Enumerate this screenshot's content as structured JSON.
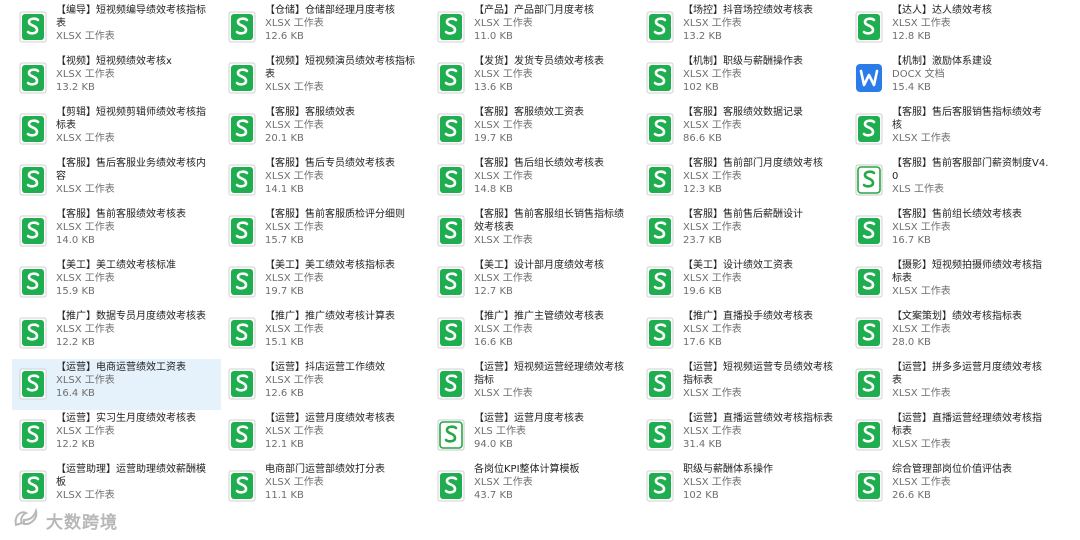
{
  "files": [
    {
      "name": "【编导】短视频编导绩效考核指标表",
      "type": "XLSX 工作表",
      "size": "",
      "icon": "xlsx-icon"
    },
    {
      "name": "【视频】短视频绩效考核x",
      "type": "XLSX 工作表",
      "size": "13.2 KB",
      "icon": "xlsx-icon"
    },
    {
      "name": "【剪辑】短视频剪辑师绩效考核指标表",
      "type": "XLSX 工作表",
      "size": "",
      "icon": "xlsx-icon"
    },
    {
      "name": "【客服】售后客服业务绩效考核内容",
      "type": "XLSX 工作表",
      "size": "",
      "icon": "xlsx-icon"
    },
    {
      "name": "【客服】售前客服绩效考核表",
      "type": "XLSX 工作表",
      "size": "14.0 KB",
      "icon": "xlsx-icon"
    },
    {
      "name": "【美工】美工绩效考核标准",
      "type": "XLSX 工作表",
      "size": "15.9 KB",
      "icon": "xlsx-icon"
    },
    {
      "name": "【推广】数据专员月度绩效考核表",
      "type": "XLSX 工作表",
      "size": "12.2 KB",
      "icon": "xlsx-icon"
    },
    {
      "name": "【运营】电商运营绩效工资表",
      "type": "XLSX 工作表",
      "size": "16.4 KB",
      "icon": "xlsx-icon",
      "selected": true
    },
    {
      "name": "【运营】实习生月度绩效考核表",
      "type": "XLSX 工作表",
      "size": "12.2 KB",
      "icon": "xlsx-icon"
    },
    {
      "name": "【运营助理】运营助理绩效薪酬模板",
      "type": "XLSX 工作表",
      "size": "",
      "icon": "xlsx-icon"
    },
    {
      "name": "【仓储】仓储部经理月度考核",
      "type": "XLSX 工作表",
      "size": "12.6 KB",
      "icon": "xlsx-icon"
    },
    {
      "name": "【视频】短视频演员绩效考核指标表",
      "type": "XLSX 工作表",
      "size": "",
      "icon": "xlsx-icon"
    },
    {
      "name": "【客服】客服绩效表",
      "type": "XLSX 工作表",
      "size": "20.1 KB",
      "icon": "xlsx-icon"
    },
    {
      "name": "【客服】售后专员绩效考核表",
      "type": "XLSX 工作表",
      "size": "14.1 KB",
      "icon": "xlsx-icon"
    },
    {
      "name": "【客服】售前客服质检评分细则",
      "type": "XLSX 工作表",
      "size": "15.7 KB",
      "icon": "xlsx-icon"
    },
    {
      "name": "【美工】美工绩效考核指标表",
      "type": "XLSX 工作表",
      "size": "19.7 KB",
      "icon": "xlsx-icon"
    },
    {
      "name": "【推广】推广绩效考核计算表",
      "type": "XLSX 工作表",
      "size": "15.1 KB",
      "icon": "xlsx-icon"
    },
    {
      "name": "【运营】抖店运营工作绩效",
      "type": "XLSX 工作表",
      "size": "12.6 KB",
      "icon": "xlsx-icon"
    },
    {
      "name": "【运营】运营月度绩效考核表",
      "type": "XLSX 工作表",
      "size": "12.1 KB",
      "icon": "xlsx-icon"
    },
    {
      "name": "电商部门运营部绩效打分表",
      "type": "XLSX 工作表",
      "size": "11.1 KB",
      "icon": "xlsx-icon"
    },
    {
      "name": "【产品】产品部门月度考核",
      "type": "XLSX 工作表",
      "size": "11.0 KB",
      "icon": "xlsx-icon"
    },
    {
      "name": "【发货】发货专员绩效考核表",
      "type": "XLSX 工作表",
      "size": "13.6 KB",
      "icon": "xlsx-icon"
    },
    {
      "name": "【客服】客服绩效工资表",
      "type": "XLSX 工作表",
      "size": "19.7 KB",
      "icon": "xlsx-icon"
    },
    {
      "name": "【客服】售后组长绩效考核表",
      "type": "XLSX 工作表",
      "size": "14.8 KB",
      "icon": "xlsx-icon"
    },
    {
      "name": "【客服】售前客服组长销售指标绩效考核表",
      "type": "XLSX 工作表",
      "size": "",
      "icon": "xlsx-icon"
    },
    {
      "name": "【美工】设计部月度绩效考核",
      "type": "XLSX 工作表",
      "size": "12.7 KB",
      "icon": "xlsx-icon"
    },
    {
      "name": "【推广】推广主管绩效考核表",
      "type": "XLSX 工作表",
      "size": "16.6 KB",
      "icon": "xlsx-icon"
    },
    {
      "name": "【运营】短视频运营经理绩效考核指标",
      "type": "XLSX 工作表",
      "size": "",
      "icon": "xlsx-icon"
    },
    {
      "name": "【运营】运营月度考核表",
      "type": "XLS 工作表",
      "size": "94.0 KB",
      "icon": "xls-icon"
    },
    {
      "name": "各岗位KPI整体计算模板",
      "type": "XLSX 工作表",
      "size": "43.7 KB",
      "icon": "xlsx-icon"
    },
    {
      "name": "【场控】抖音场控绩效考核表",
      "type": "XLSX 工作表",
      "size": "13.2 KB",
      "icon": "xlsx-icon"
    },
    {
      "name": "【机制】职级与薪酬操作表",
      "type": "XLSX 工作表",
      "size": "102 KB",
      "icon": "xlsx-icon"
    },
    {
      "name": "【客服】客服绩效数据记录",
      "type": "XLSX 工作表",
      "size": "86.6 KB",
      "icon": "xlsx-icon"
    },
    {
      "name": "【客服】售前部门月度绩效考核",
      "type": "XLSX 工作表",
      "size": "12.3 KB",
      "icon": "xlsx-icon"
    },
    {
      "name": "【客服】售前售后薪酬设计",
      "type": "XLSX 工作表",
      "size": "23.7 KB",
      "icon": "xlsx-icon"
    },
    {
      "name": "【美工】设计绩效工资表",
      "type": "XLSX 工作表",
      "size": "19.6 KB",
      "icon": "xlsx-icon"
    },
    {
      "name": "【推广】直播投手绩效考核表",
      "type": "XLSX 工作表",
      "size": "17.6 KB",
      "icon": "xlsx-icon"
    },
    {
      "name": "【运营】短视频运营专员绩效考核指标表",
      "type": "XLSX 工作表",
      "size": "",
      "icon": "xlsx-icon"
    },
    {
      "name": "【运营】直播运营绩效考核指标表",
      "type": "XLSX 工作表",
      "size": "31.4 KB",
      "icon": "xlsx-icon"
    },
    {
      "name": "职级与薪酬体系操作",
      "type": "XLSX 工作表",
      "size": "102 KB",
      "icon": "xlsx-icon"
    },
    {
      "name": "【达人】达人绩效考核",
      "type": "XLSX 工作表",
      "size": "12.8 KB",
      "icon": "xlsx-icon"
    },
    {
      "name": "【机制】激励体系建设",
      "type": "DOCX 文档",
      "size": "15.4 KB",
      "icon": "docx-icon"
    },
    {
      "name": "【客服】售后客服销售指标绩效考核",
      "type": "XLSX 工作表",
      "size": "",
      "icon": "xlsx-icon"
    },
    {
      "name": "【客服】售前客服部门薪资制度V4.0",
      "type": "XLS 工作表",
      "size": "",
      "icon": "xls-icon"
    },
    {
      "name": "【客服】售前组长绩效考核表",
      "type": "XLSX 工作表",
      "size": "16.7 KB",
      "icon": "xlsx-icon"
    },
    {
      "name": "【摄影】短视频拍摄师绩效考核指标表",
      "type": "XLSX 工作表",
      "size": "",
      "icon": "xlsx-icon"
    },
    {
      "name": "【文案策划】绩效考核指标表",
      "type": "XLSX 工作表",
      "size": "28.0 KB",
      "icon": "xlsx-icon"
    },
    {
      "name": "【运营】拼多多运营月度绩效考核表",
      "type": "XLSX 工作表",
      "size": "",
      "icon": "xlsx-icon"
    },
    {
      "name": "【运营】直播运营经理绩效考核指标表",
      "type": "XLSX 工作表",
      "size": "",
      "icon": "xlsx-icon"
    },
    {
      "name": "综合管理部岗位价值评估表",
      "type": "XLSX 工作表",
      "size": "26.6 KB",
      "icon": "xlsx-icon"
    }
  ],
  "watermark": {
    "text": "大数跨境",
    "icon": "watermark-logo-icon"
  },
  "colors": {
    "xlsx_green": "#1fae4f",
    "xls_green": "#27a846",
    "docx_blue": "#2b7ce9",
    "selected_bg": "#e5f1fb"
  }
}
